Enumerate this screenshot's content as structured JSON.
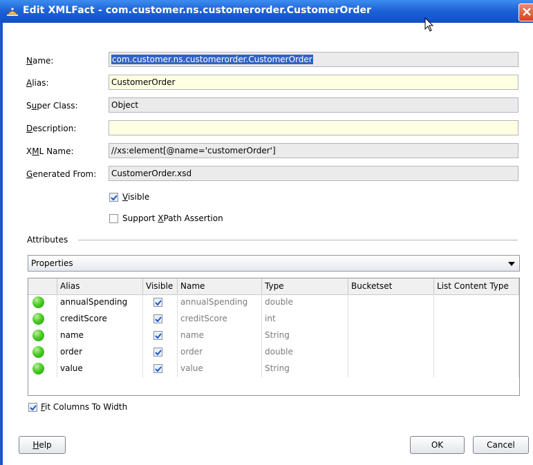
{
  "window": {
    "title": "Edit XMLFact - com.customer.ns.customerorder.CustomerOrder",
    "accent": "#1f63d8"
  },
  "form": {
    "name_label": "Name:",
    "name_value": "com.customer.ns.customerorder.CustomerOrder",
    "alias_label": "Alias:",
    "alias_value": "CustomerOrder",
    "superclass_label": "Super Class:",
    "superclass_value": "Object",
    "description_label": "Description:",
    "description_value": "",
    "xmlname_label": "XML Name:",
    "xmlname_value": "//xs:element[@name='customerOrder']",
    "generated_label": "Generated From:",
    "generated_value": "CustomerOrder.xsd",
    "visible_label": "Visible",
    "visible_checked": true,
    "xpath_label": "Support XPath Assertion",
    "xpath_checked": false
  },
  "attributes": {
    "section_label": "Attributes",
    "dropdown_value": "Properties",
    "columns": [
      "Alias",
      "Visible",
      "Name",
      "Type",
      "Bucketset",
      "List Content Type"
    ],
    "rows": [
      {
        "alias": "annualSpending",
        "visible": true,
        "name": "annualSpending",
        "type": "double",
        "bucketset": "",
        "list_content_type": ""
      },
      {
        "alias": "creditScore",
        "visible": true,
        "name": "creditScore",
        "type": "int",
        "bucketset": "",
        "list_content_type": ""
      },
      {
        "alias": "name",
        "visible": true,
        "name": "name",
        "type": "String",
        "bucketset": "",
        "list_content_type": ""
      },
      {
        "alias": "order",
        "visible": true,
        "name": "order",
        "type": "double",
        "bucketset": "",
        "list_content_type": ""
      },
      {
        "alias": "value",
        "visible": true,
        "name": "value",
        "type": "String",
        "bucketset": "",
        "list_content_type": ""
      }
    ]
  },
  "fit_columns_label": "Fit Columns To Width",
  "fit_columns_checked": true,
  "buttons": {
    "help": "Help",
    "ok": "OK",
    "cancel": "Cancel"
  }
}
